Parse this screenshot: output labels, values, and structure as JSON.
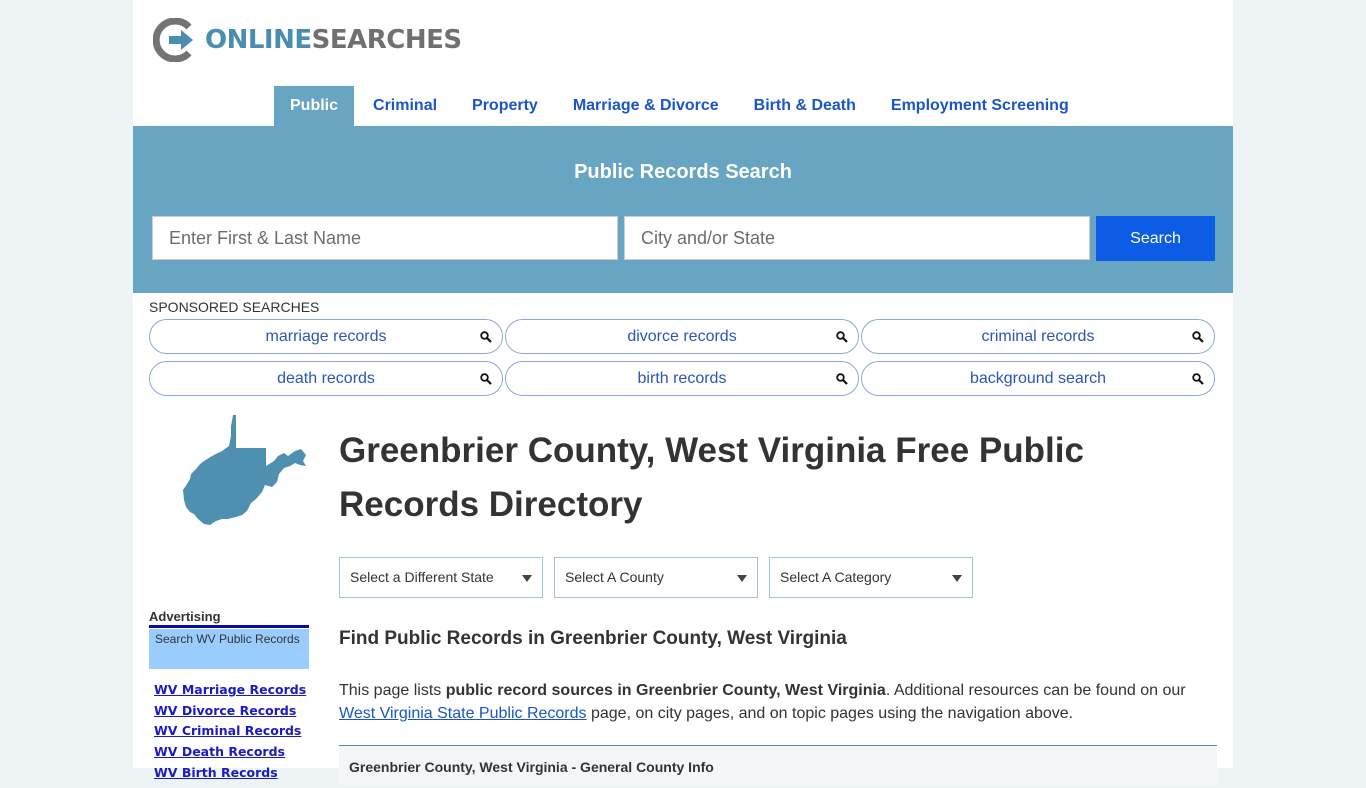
{
  "logo": {
    "part1": "ONLINE",
    "part2": "SEARCHES",
    "icon": "logo-arrow-icon"
  },
  "nav": {
    "items": [
      {
        "label": "Public",
        "active": true
      },
      {
        "label": "Criminal"
      },
      {
        "label": "Property"
      },
      {
        "label": "Marriage & Divorce"
      },
      {
        "label": "Birth & Death"
      },
      {
        "label": "Employment Screening"
      }
    ]
  },
  "search": {
    "title": "Public Records Search",
    "name_placeholder": "Enter First & Last Name",
    "city_placeholder": "City and/or State",
    "button_label": "Search"
  },
  "sponsored": {
    "label": "SPONSORED SEARCHES",
    "items": [
      {
        "label": "marriage records",
        "icon": "search-icon"
      },
      {
        "label": "divorce records",
        "icon": "search-icon"
      },
      {
        "label": "criminal records",
        "icon": "search-icon"
      },
      {
        "label": "death records",
        "icon": "search-icon"
      },
      {
        "label": "birth records",
        "icon": "search-icon"
      },
      {
        "label": "background search",
        "icon": "search-icon"
      }
    ]
  },
  "main": {
    "title": "Greenbrier County, West Virginia Free Public Records Directory",
    "selects": [
      {
        "value": "Select a Different State"
      },
      {
        "value": "Select A County"
      },
      {
        "value": "Select A Category"
      }
    ],
    "subheading": "Find Public Records in Greenbrier County, West Virginia",
    "intro_1": "This page lists ",
    "intro_bold": "public record sources in Greenbrier County, West Virginia",
    "intro_2": ". Additional resources can be found on our ",
    "intro_link": "West Virginia State Public Records",
    "intro_3": " page, on city pages, and on topic pages using the navigation above.",
    "info_box_title": "Greenbrier County, West Virginia - General County Info"
  },
  "sidebar": {
    "advertising_label": "Advertising",
    "ad_box": "Search WV Public Records",
    "links": [
      "WV Marriage Records",
      "WV Divorce Records",
      "WV Criminal Records",
      "WV Death Records",
      "WV Birth Records"
    ]
  },
  "colors": {
    "accent": "#68a5c2",
    "button": "#0d5ce5",
    "link": "#1a56c4",
    "map": "#4f8fb0"
  }
}
